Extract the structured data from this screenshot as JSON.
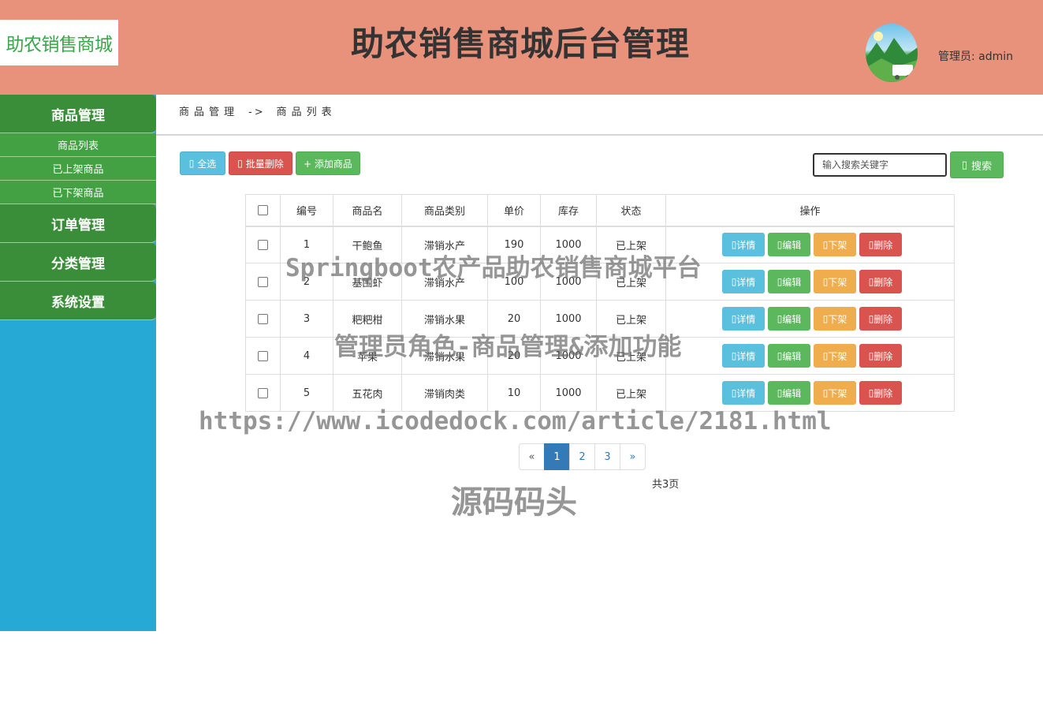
{
  "header": {
    "logo_text": "助农销售商城",
    "title": "助农销售商城后台管理",
    "admin_label": "管理员: admin"
  },
  "sidebar": {
    "groups": [
      {
        "label": "商品管理",
        "items": [
          {
            "label": "商品列表"
          },
          {
            "label": "已上架商品"
          },
          {
            "label": "已下架商品"
          }
        ]
      },
      {
        "label": "订单管理"
      },
      {
        "label": "分类管理"
      },
      {
        "label": "系统设置"
      }
    ]
  },
  "breadcrumb": {
    "parent": "商品管理",
    "separator": "->",
    "current": "商品列表"
  },
  "toolbar": {
    "select_all": "全选",
    "batch_delete": "批量删除",
    "add_product": "+ 添加商品",
    "search_placeholder": "输入搜索关键字",
    "search_button": "搜索"
  },
  "table": {
    "columns": [
      "编号",
      "商品名",
      "商品类别",
      "单价",
      "库存",
      "状态",
      "操作"
    ],
    "rows": [
      {
        "id": "1",
        "name": "干鲍鱼",
        "category": "滞销水产",
        "price": "190",
        "stock": "1000",
        "status": "已上架"
      },
      {
        "id": "2",
        "name": "基围虾",
        "category": "滞销水产",
        "price": "100",
        "stock": "1000",
        "status": "已上架"
      },
      {
        "id": "3",
        "name": "粑粑柑",
        "category": "滞销水果",
        "price": "20",
        "stock": "1000",
        "status": "已上架"
      },
      {
        "id": "4",
        "name": "苹果",
        "category": "滞销水果",
        "price": "20",
        "stock": "1000",
        "status": "已上架"
      },
      {
        "id": "5",
        "name": "五花肉",
        "category": "滞销肉类",
        "price": "10",
        "stock": "1000",
        "status": "已上架"
      }
    ],
    "actions": {
      "detail": "详情",
      "edit": "编辑",
      "offshelf": "下架",
      "delete": "删除"
    }
  },
  "pagination": {
    "prev": "«",
    "pages": [
      "1",
      "2",
      "3"
    ],
    "current": "1",
    "next": "»",
    "total": "共3页"
  },
  "watermarks": {
    "line1": "Springboot农产品助农销售商城平台",
    "line2": "管理员角色-商品管理&添加功能",
    "line3": "https://www.icodedock.com/article/2181.html",
    "line4": "源码码头"
  },
  "colors": {
    "header_bg": "#e8927c",
    "sidebar_bg": "#27a9d5",
    "menu_green": "#3a8e3a",
    "info": "#5bc0de",
    "success": "#5cb85c",
    "warning": "#f0ad4e",
    "danger": "#d9534f",
    "primary": "#337ab7"
  }
}
